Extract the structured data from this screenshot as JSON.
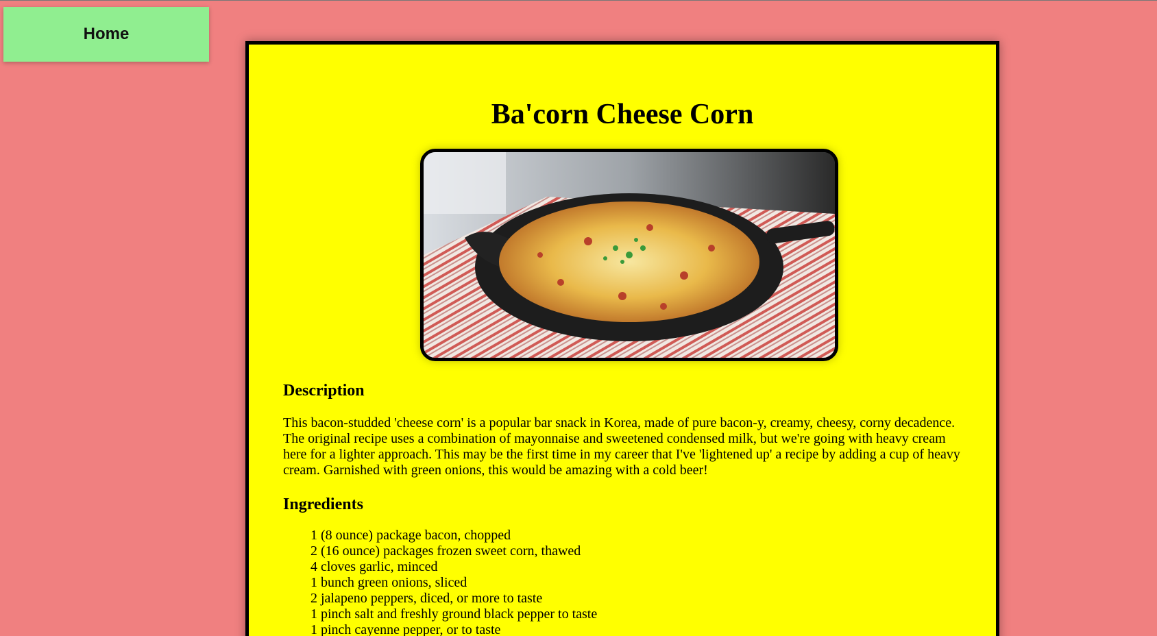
{
  "nav": {
    "home_label": "Home"
  },
  "recipe": {
    "title": "Ba'corn Cheese Corn",
    "image_alt": "cheese corn in cast iron skillet",
    "description_heading": "Description",
    "description": "This bacon-studded 'cheese corn' is a popular bar snack in Korea, made of pure bacon-y, creamy, cheesy, corny decadence. The original recipe uses a combination of mayonnaise and sweetened condensed milk, but we're going with heavy cream here for a lighter approach. This may be the first time in my career that I've 'lightened up' a recipe by adding a cup of heavy cream. Garnished with green onions, this would be amazing with a cold beer!",
    "ingredients_heading": "Ingredients",
    "ingredients": [
      "1 (8 ounce) package bacon, chopped",
      "2 (16 ounce) packages frozen sweet corn, thawed",
      "4 cloves garlic, minced",
      "1 bunch green onions, sliced",
      "2 jalapeno peppers, diced, or more to taste",
      "1 pinch salt and freshly ground black pepper to taste",
      "1 pinch cayenne pepper, or to taste"
    ]
  },
  "colors": {
    "page_background": "#f08080",
    "home_button": "#90ee90",
    "card_background": "#ffff00",
    "card_border": "#000000"
  }
}
